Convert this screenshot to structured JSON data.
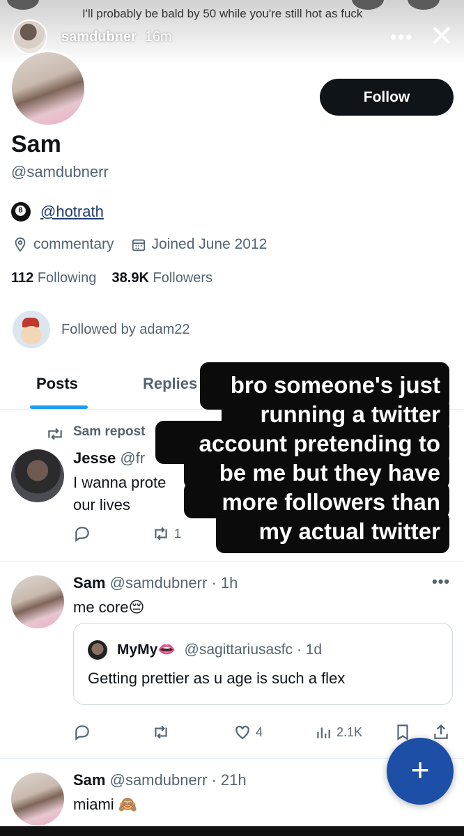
{
  "story": {
    "caption": "I'll probably be bald by 50 while you're still hot as fuck",
    "username": "samdubner",
    "time": "16m",
    "more_icon": "more-horizontal-icon",
    "close_icon": "close-icon"
  },
  "profile": {
    "follow_label": "Follow",
    "display_name": "Sam",
    "handle": "@samdubnerr",
    "affiliate_link": "@hotrath",
    "location": "commentary",
    "joined": "Joined June 2012",
    "following_count": "112",
    "following_label": "Following",
    "followers_count": "38.9K",
    "followers_label": "Followers",
    "followed_by": "Followed by adam22"
  },
  "tabs": {
    "posts": "Posts",
    "replies": "Replies"
  },
  "overlay": {
    "lines": [
      "bro someone's just",
      "running a twitter",
      "account pretending to",
      "be me but they have",
      "more followers than",
      "my actual twitter"
    ]
  },
  "posts": [
    {
      "repost_label": "Sam repost",
      "name": "Jesse",
      "handle": "@fr",
      "text_line1": "I wanna prote",
      "text_line2": "our lives",
      "repost_count": "1"
    },
    {
      "name": "Sam",
      "handle_time": "@samdubnerr · 1h",
      "text": "me core😔",
      "quote": {
        "name": "MyMy👄",
        "handle_time": "@sagittariusasfc · 1d",
        "text": "Getting prettier as u age is such a flex"
      },
      "like_count": "4",
      "view_count": "2.1K"
    },
    {
      "name": "Sam",
      "handle_time": "@samdubnerr · 21h",
      "text": "miami 🙈"
    }
  ],
  "colors": {
    "accent": "#1d9bf0",
    "fab": "#1d4fa6",
    "text": "#0f1419",
    "muted": "#536471"
  }
}
